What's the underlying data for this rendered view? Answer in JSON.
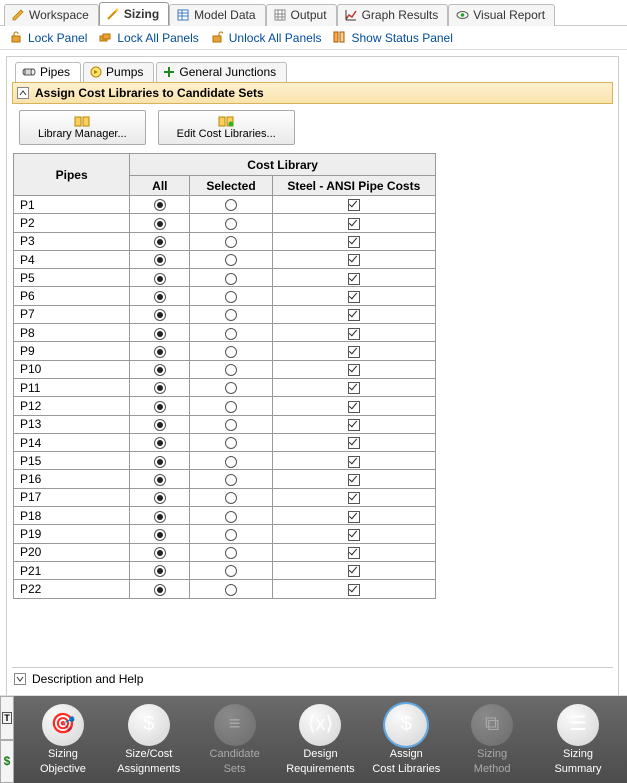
{
  "tabs": [
    {
      "label": "Workspace",
      "icon": "pencil-icon",
      "active": false
    },
    {
      "label": "Sizing",
      "icon": "wand-icon",
      "active": true
    },
    {
      "label": "Model Data",
      "icon": "table-icon",
      "active": false
    },
    {
      "label": "Output",
      "icon": "grid-icon",
      "active": false
    },
    {
      "label": "Graph Results",
      "icon": "chart-icon",
      "active": false
    },
    {
      "label": "Visual Report",
      "icon": "eye-icon",
      "active": false
    }
  ],
  "toolbar": {
    "lock_panel": "Lock Panel",
    "lock_all": "Lock All Panels",
    "unlock_all": "Unlock All Panels",
    "show_status": "Show Status Panel"
  },
  "subtabs": [
    {
      "label": "Pipes",
      "icon": "pipe-icon",
      "active": true
    },
    {
      "label": "Pumps",
      "icon": "pump-icon",
      "active": false
    },
    {
      "label": "General Junctions",
      "icon": "junction-icon",
      "active": false
    }
  ],
  "section_title": "Assign Cost Libraries to Candidate Sets",
  "buttons": {
    "library_manager": "Library Manager...",
    "edit_cost": "Edit Cost Libraries..."
  },
  "grid": {
    "header_pipes": "Pipes",
    "header_costlib": "Cost Library",
    "col_all": "All",
    "col_selected": "Selected",
    "col_lib": "Steel - ANSI Pipe Costs",
    "rows": [
      {
        "name": "P1",
        "option": "all",
        "lib": true
      },
      {
        "name": "P2",
        "option": "all",
        "lib": true
      },
      {
        "name": "P3",
        "option": "all",
        "lib": true
      },
      {
        "name": "P4",
        "option": "all",
        "lib": true
      },
      {
        "name": "P5",
        "option": "all",
        "lib": true
      },
      {
        "name": "P6",
        "option": "all",
        "lib": true
      },
      {
        "name": "P7",
        "option": "all",
        "lib": true
      },
      {
        "name": "P8",
        "option": "all",
        "lib": true
      },
      {
        "name": "P9",
        "option": "all",
        "lib": true
      },
      {
        "name": "P10",
        "option": "all",
        "lib": true
      },
      {
        "name": "P11",
        "option": "all",
        "lib": true
      },
      {
        "name": "P12",
        "option": "all",
        "lib": true
      },
      {
        "name": "P13",
        "option": "all",
        "lib": true
      },
      {
        "name": "P14",
        "option": "all",
        "lib": true
      },
      {
        "name": "P15",
        "option": "all",
        "lib": true
      },
      {
        "name": "P16",
        "option": "all",
        "lib": true
      },
      {
        "name": "P17",
        "option": "all",
        "lib": true
      },
      {
        "name": "P18",
        "option": "all",
        "lib": true
      },
      {
        "name": "P19",
        "option": "all",
        "lib": true
      },
      {
        "name": "P20",
        "option": "all",
        "lib": true
      },
      {
        "name": "P21",
        "option": "all",
        "lib": true
      },
      {
        "name": "P22",
        "option": "all",
        "lib": true
      }
    ]
  },
  "description_label": "Description and Help",
  "nav": [
    {
      "l1": "Sizing",
      "l2": "Objective",
      "disabled": false,
      "active": false,
      "glyph": "🎯"
    },
    {
      "l1": "Size/Cost",
      "l2": "Assignments",
      "disabled": false,
      "active": false,
      "glyph": "$"
    },
    {
      "l1": "Candidate",
      "l2": "Sets",
      "disabled": true,
      "active": false,
      "glyph": "≡"
    },
    {
      "l1": "Design",
      "l2": "Requirements",
      "disabled": false,
      "active": false,
      "glyph": "⟨x⟩"
    },
    {
      "l1": "Assign",
      "l2": "Cost Libraries",
      "disabled": false,
      "active": true,
      "glyph": "$"
    },
    {
      "l1": "Sizing",
      "l2": "Method",
      "disabled": true,
      "active": false,
      "glyph": "⧉"
    },
    {
      "l1": "Sizing",
      "l2": "Summary",
      "disabled": false,
      "active": false,
      "glyph": "☰"
    }
  ]
}
